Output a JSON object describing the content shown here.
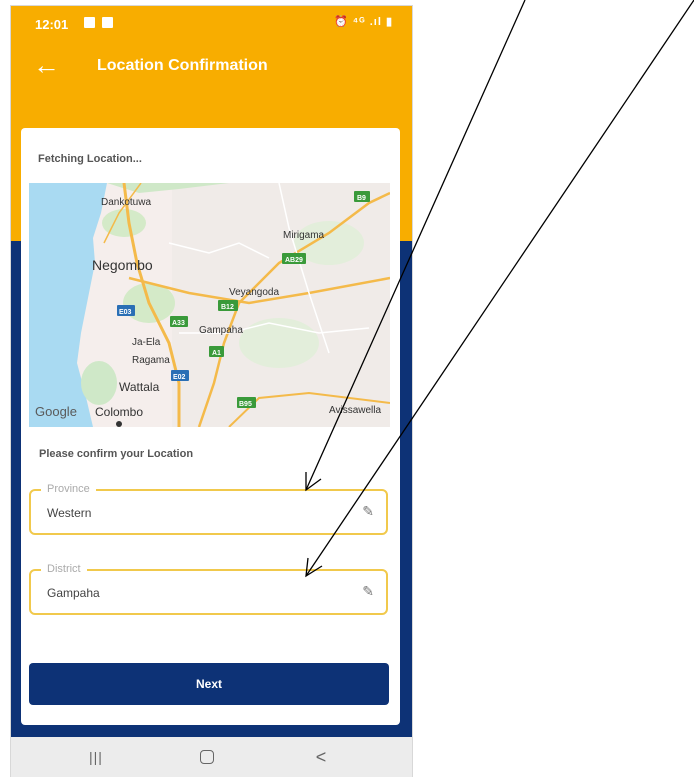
{
  "status_bar": {
    "time": "12:01",
    "right_icons_text": "⏰ ⁴ᴳ .ıl ▮"
  },
  "app_bar": {
    "title": "Location Confirmation",
    "back_icon": "arrow-left-icon",
    "background": "#f8ad00"
  },
  "card": {
    "fetching_text": "Fetching Location...",
    "confirm_label": "Please confirm your Location",
    "map": {
      "places": [
        "Dankotuwa",
        "Mirigama",
        "Negombo",
        "Veyangoda",
        "Gampaha",
        "Ja-Ela",
        "Ragama",
        "Wattala",
        "Colombo",
        "Avissawella"
      ],
      "road_badges": [
        "B9",
        "AB29",
        "B12",
        "E03",
        "A33",
        "A1",
        "E02",
        "B95"
      ],
      "logo": "Google"
    },
    "province": {
      "label": "Province",
      "value": "Western",
      "edit_icon": "pencil-icon"
    },
    "district": {
      "label": "District",
      "value": "Gampaha",
      "edit_icon": "pencil-icon"
    },
    "next_label": "Next"
  },
  "nav_bar": {
    "recent_glyph": "|||",
    "back_glyph": "<"
  },
  "colors": {
    "accent": "#f8ad00",
    "navy": "#0d3276",
    "field_border": "#f1c94c",
    "map_land": "#f5eeec",
    "map_water": "#a9daf2",
    "map_road": "#f4ba4a"
  }
}
